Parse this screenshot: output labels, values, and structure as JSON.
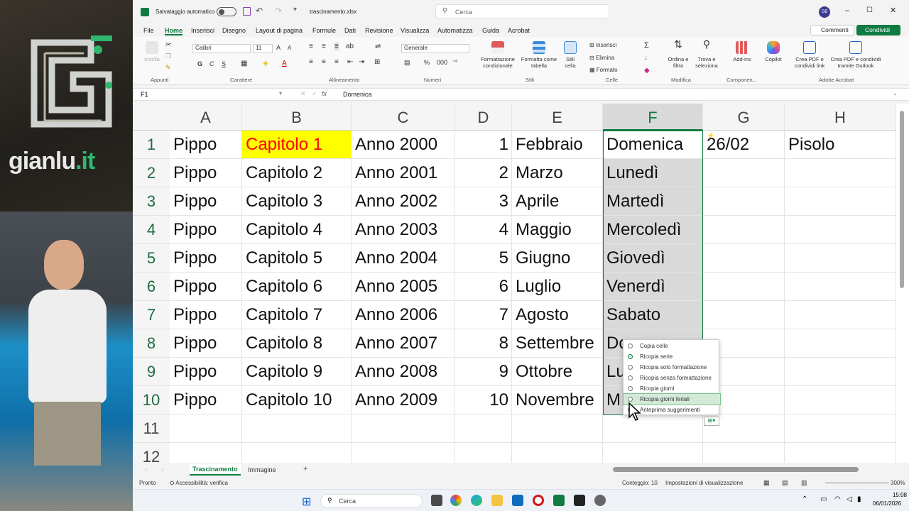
{
  "video": {
    "brand": "gianlu",
    "brand_tld": ".it"
  },
  "titlebar": {
    "autosave_label": "Salvataggio automatico",
    "filename": "trascinamento.xlsx",
    "search_placeholder": "Cerca",
    "user_initials": "GB"
  },
  "ribbon_tabs": [
    "File",
    "Home",
    "Inserisci",
    "Disegno",
    "Layout di pagina",
    "Formule",
    "Dati",
    "Revisione",
    "Visualizza",
    "Automatizza",
    "Guida",
    "Acrobat"
  ],
  "ribbon_actions": {
    "comments": "Commenti",
    "share": "Condividi"
  },
  "ribbon": {
    "paste": "Incolla",
    "font_name": "Calibri",
    "font_size": "11",
    "number_format": "Generale",
    "groups": {
      "clipboard": "Appunti",
      "font": "Carattere",
      "alignment": "Allineamento",
      "number": "Numeri",
      "styles": "Stili",
      "cells": "Celle",
      "editing": "Modifica",
      "addins": "Componen...",
      "acrobat": "Adobe Acrobat"
    },
    "cond_format": "Formattazione condizionale",
    "format_table": "Formatta come tabella",
    "cell_styles": "Stili cella",
    "insert": "Inserisci",
    "delete": "Elimina",
    "format": "Formato",
    "sort": "Ordina e filtra",
    "find": "Trova e seleziona",
    "addins": "Add-ins",
    "copilot": "Copilot",
    "pdf_link": "Crea PDF e condividi link",
    "pdf_outlook": "Crea PDF e condividi tramite Outlook"
  },
  "formula_bar": {
    "name_box": "F1",
    "fx": "fx",
    "value": "Domenica"
  },
  "columns": [
    "A",
    "B",
    "C",
    "D",
    "E",
    "F",
    "G",
    "H"
  ],
  "rows": [
    {
      "n": "1",
      "a": "Pippo",
      "b": "Capitolo 1",
      "c": "Anno 2000",
      "d": "1",
      "e": "Febbraio",
      "f": "Domenica",
      "g": "26/02",
      "h": "Pisolo"
    },
    {
      "n": "2",
      "a": "Pippo",
      "b": "Capitolo 2",
      "c": "Anno 2001",
      "d": "2",
      "e": "Marzo",
      "f": "Lunedì",
      "g": "",
      "h": ""
    },
    {
      "n": "3",
      "a": "Pippo",
      "b": "Capitolo 3",
      "c": "Anno 2002",
      "d": "3",
      "e": "Aprile",
      "f": "Martedì",
      "g": "",
      "h": ""
    },
    {
      "n": "4",
      "a": "Pippo",
      "b": "Capitolo 4",
      "c": "Anno 2003",
      "d": "4",
      "e": "Maggio",
      "f": "Mercoledì",
      "g": "",
      "h": ""
    },
    {
      "n": "5",
      "a": "Pippo",
      "b": "Capitolo 5",
      "c": "Anno 2004",
      "d": "5",
      "e": "Giugno",
      "f": "Giovedì",
      "g": "",
      "h": ""
    },
    {
      "n": "6",
      "a": "Pippo",
      "b": "Capitolo 6",
      "c": "Anno 2005",
      "d": "6",
      "e": "Luglio",
      "f": "Venerdì",
      "g": "",
      "h": ""
    },
    {
      "n": "7",
      "a": "Pippo",
      "b": "Capitolo 7",
      "c": "Anno 2006",
      "d": "7",
      "e": "Agosto",
      "f": "Sabato",
      "g": "",
      "h": ""
    },
    {
      "n": "8",
      "a": "Pippo",
      "b": "Capitolo 8",
      "c": "Anno 2007",
      "d": "8",
      "e": "Settembre",
      "f": "Do",
      "g": "",
      "h": ""
    },
    {
      "n": "9",
      "a": "Pippo",
      "b": "Capitolo 9",
      "c": "Anno 2008",
      "d": "9",
      "e": "Ottobre",
      "f": "Lu",
      "g": "",
      "h": ""
    },
    {
      "n": "10",
      "a": "Pippo",
      "b": "Capitolo 10",
      "c": "Anno 2009",
      "d": "10",
      "e": "Novembre",
      "f": "M",
      "g": "",
      "h": ""
    },
    {
      "n": "11",
      "a": "",
      "b": "",
      "c": "",
      "d": "",
      "e": "",
      "f": "",
      "g": "",
      "h": ""
    },
    {
      "n": "12",
      "a": "",
      "b": "",
      "c": "",
      "d": "",
      "e": "",
      "f": "",
      "g": "",
      "h": ""
    }
  ],
  "autofill_menu": [
    {
      "label": "Copia celle",
      "selected": false,
      "hover": false
    },
    {
      "label": "Ricopia serie",
      "selected": true,
      "hover": false
    },
    {
      "label": "Ricopia solo formattazione",
      "selected": false,
      "hover": false
    },
    {
      "label": "Ricopia senza formattazione",
      "selected": false,
      "hover": false
    },
    {
      "label": "Ricopia giorni",
      "selected": false,
      "hover": false
    },
    {
      "label": "Ricopia giorni feriali",
      "selected": false,
      "hover": true
    },
    {
      "label": "Anteprima suggerimenti",
      "selected": false,
      "hover": false
    }
  ],
  "sheet_tabs": {
    "active": "Trascinamento",
    "other": "Immagine",
    "add": "+"
  },
  "status": {
    "ready": "Pronto",
    "accessibility": "Accessibilità: verifica",
    "count": "Conteggio: 10",
    "view_settings": "Impostazioni di visualizzazione",
    "zoom": "300%"
  },
  "taskbar": {
    "search": "Cerca",
    "time": "15:08",
    "date": "06/01/2026"
  },
  "colors": {
    "excel_green": "#107c41",
    "highlight_yellow": "#ffff00",
    "red_text": "#ff0000",
    "selection_gray": "#d9d9d9"
  }
}
